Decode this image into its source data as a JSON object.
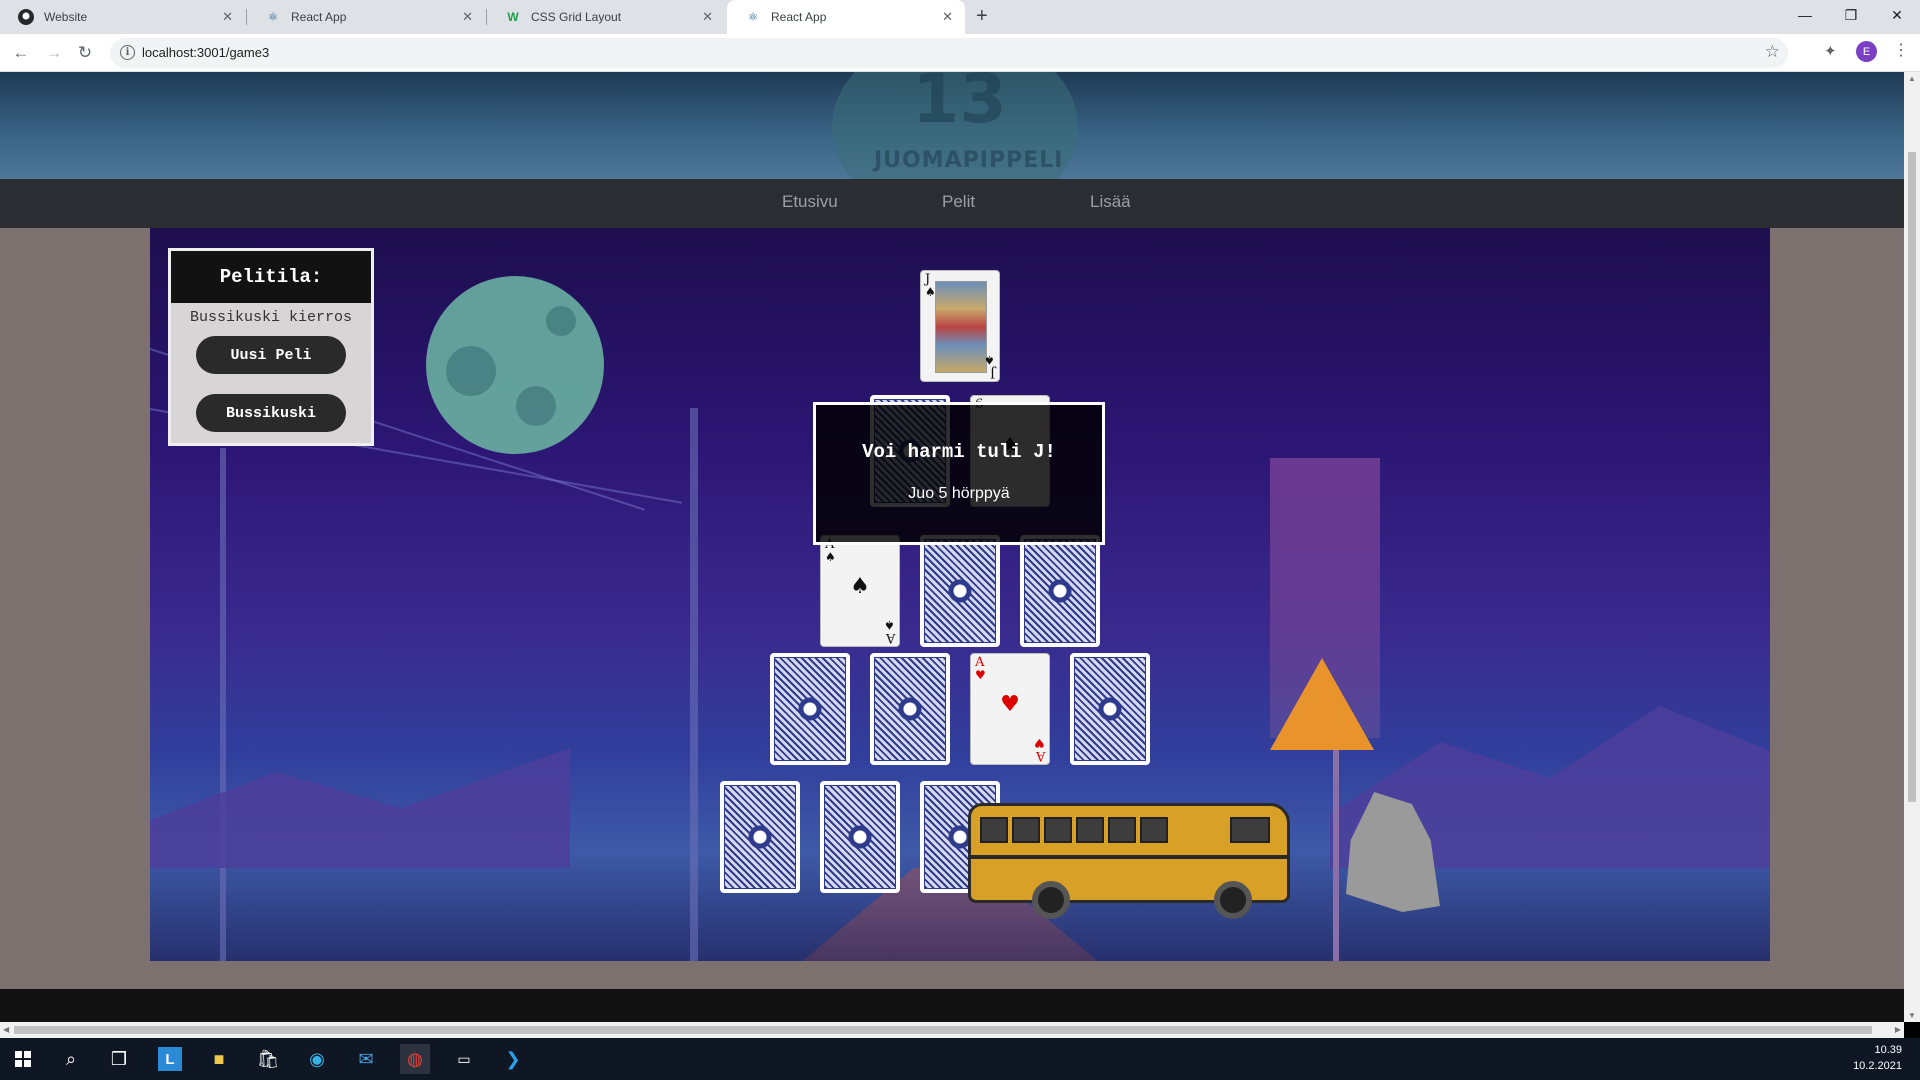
{
  "browser": {
    "tabs": [
      {
        "title": "Website",
        "icon": "github-icon"
      },
      {
        "title": "React App",
        "icon": "react-icon"
      },
      {
        "title": "CSS Grid Layout",
        "icon": "w-icon"
      },
      {
        "title": "React App",
        "icon": "react-icon"
      }
    ],
    "active_tab": 3,
    "url": "localhost:3001/game3",
    "profile_initial": "E"
  },
  "site": {
    "logo_number": "13",
    "logo_text": "JUOMAPIPPELI",
    "nav": [
      "Etusivu",
      "Pelit",
      "Lisää"
    ]
  },
  "panel": {
    "title": "Pelitila:",
    "status": "Bussikuski kierros",
    "new_game_label": "Uusi Peli",
    "bus_driver_label": "Bussikuski"
  },
  "cards": {
    "top": {
      "rank": "J",
      "suit": "♠",
      "color": "#111111"
    },
    "row2": [
      {
        "face": "back"
      },
      {
        "rank": "6",
        "suit": "♠",
        "color": "#111111"
      }
    ],
    "row3": [
      {
        "rank": "A",
        "suit": "♠",
        "color": "#111111"
      },
      {
        "face": "back"
      },
      {
        "face": "back"
      }
    ],
    "row4": [
      {
        "face": "back"
      },
      {
        "face": "back"
      },
      {
        "rank": "A",
        "suit": "♥",
        "color": "#dd0000"
      },
      {
        "face": "back"
      }
    ],
    "row5": [
      {
        "face": "back"
      },
      {
        "face": "back"
      },
      {
        "face": "back"
      }
    ]
  },
  "modal": {
    "title": "Voi harmi tuli J!",
    "message": "Juo 5 hörppyä"
  },
  "taskbar": {
    "time": "10.39",
    "date": "10.2.2021"
  },
  "colors": {
    "panel_title_bg": "#121212",
    "button_bg": "#2a2a2a",
    "navbar_bg": "#2b2d33"
  }
}
